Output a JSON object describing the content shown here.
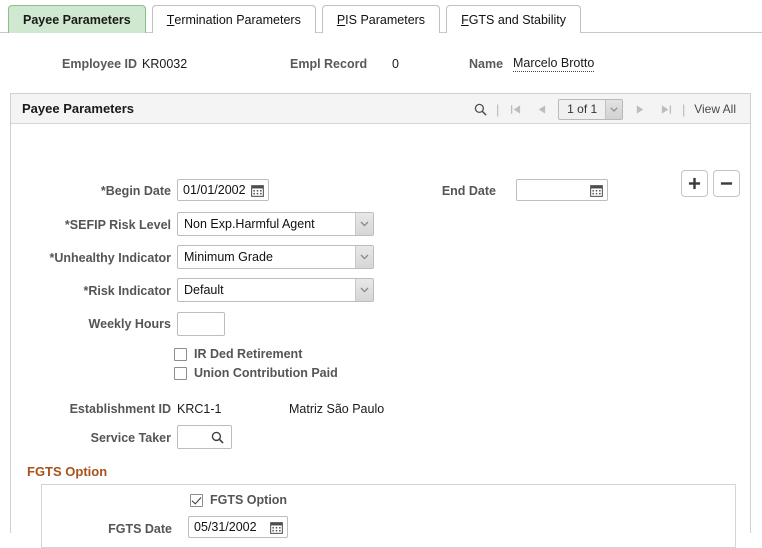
{
  "tabs": [
    {
      "label": "Payee Parameters",
      "accel": "",
      "active": true
    },
    {
      "label": "Termination Parameters",
      "accel": "T",
      "active": false
    },
    {
      "label": "PIS Parameters",
      "accel": "P",
      "active": false
    },
    {
      "label": "FGTS and Stability",
      "accel": "F",
      "active": false
    }
  ],
  "employee": {
    "id_label": "Employee ID",
    "id_value": "KR0032",
    "record_label": "Empl Record",
    "record_value": "0",
    "name_label": "Name",
    "name_value": "Marcelo Brotto"
  },
  "panel": {
    "title": "Payee Parameters",
    "search_icon": "search-icon",
    "first_icon": "first-page-icon",
    "prev_icon": "previous-page-icon",
    "counter": "1 of 1",
    "next_icon": "next-page-icon",
    "last_icon": "last-page-icon",
    "view_all": "View All"
  },
  "form": {
    "begin_date_label": "*Begin Date",
    "begin_date_value": "01/01/2002",
    "end_date_label": "End Date",
    "end_date_value": "",
    "sefip_label": "*SEFIP Risk Level",
    "sefip_value": "Non Exp.Harmful Agent",
    "unhealthy_label": "*Unhealthy Indicator",
    "unhealthy_value": "Minimum Grade",
    "risk_label": "*Risk Indicator",
    "risk_value": "Default",
    "weekly_hours_label": "Weekly Hours",
    "weekly_hours_value": "",
    "ir_ded_label": "IR Ded Retirement",
    "ir_ded_checked": false,
    "union_label": "Union Contribution Paid",
    "union_checked": false,
    "establishment_label": "Establishment ID",
    "establishment_value": "KRC1-1",
    "establishment_desc": "Matriz São Paulo",
    "service_taker_label": "Service Taker",
    "service_taker_value": "",
    "add_row_label": "+",
    "delete_row_label": "−"
  },
  "fgts": {
    "group_title": "FGTS Option",
    "option_label": "FGTS Option",
    "option_checked": true,
    "date_label": "FGTS Date",
    "date_value": "05/31/2002"
  },
  "colors": {
    "active_tab_bg": "#cfe8cf",
    "active_tab_border": "#8cbf8c",
    "group_title": "#a8521c",
    "label_text": "#555555"
  }
}
